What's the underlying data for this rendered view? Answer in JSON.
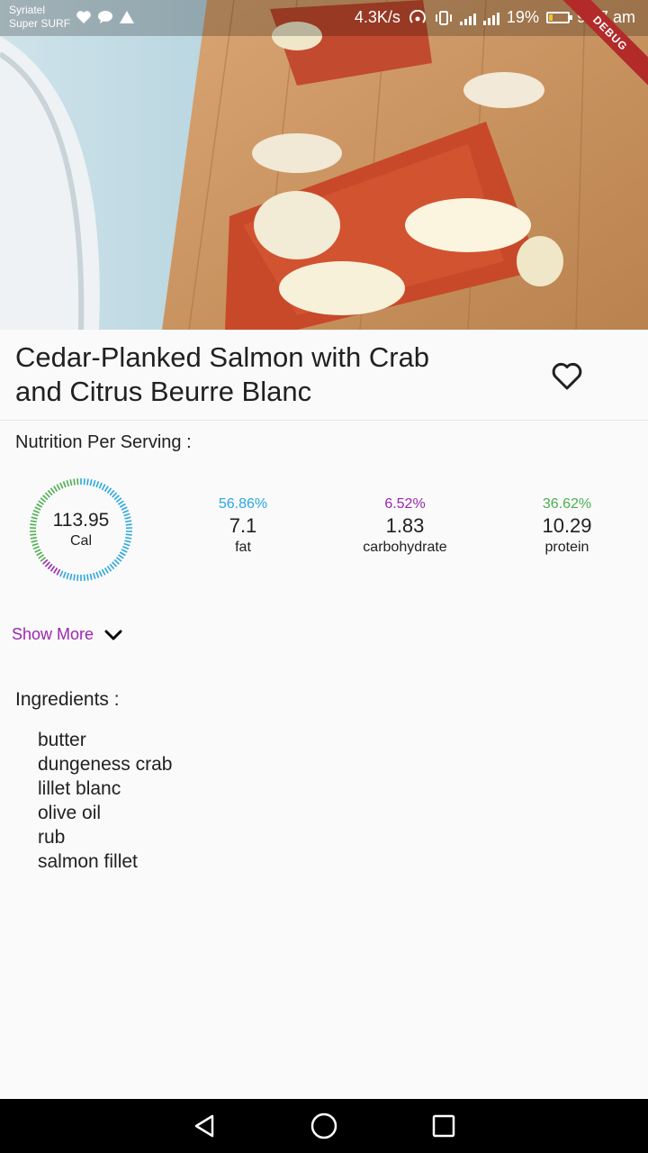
{
  "status_bar": {
    "carrier_line1": "Syriatel",
    "carrier_line2": "Super SURF",
    "speed": "4.3K/s",
    "battery": "19%",
    "time": "9:07 am",
    "battery_level": 0.19
  },
  "debug_banner": "DEBUG",
  "recipe": {
    "title_line1": "Cedar-Planked Salmon with Crab",
    "title_line2": "and Citrus Beurre Blanc",
    "favorite_icon": "heart-outline-icon"
  },
  "nutrition": {
    "heading": "Nutrition Per Serving :",
    "calories": "113.95",
    "calories_unit": "Cal",
    "macros": [
      {
        "percent": "56.86%",
        "value": "7.1",
        "label": "fat",
        "color": "#2aa7e0"
      },
      {
        "percent": "6.52%",
        "value": "1.83",
        "label": "carbohydrate",
        "color": "#9c27b0"
      },
      {
        "percent": "36.62%",
        "value": "10.29",
        "label": "protein",
        "color": "#4caf50"
      }
    ]
  },
  "show_more": {
    "label": "Show More",
    "icon": "chevron-down-icon",
    "color": "#9c27b0"
  },
  "ingredients": {
    "heading": "Ingredients :",
    "items": [
      "butter",
      "dungeness crab",
      "lillet blanc",
      "olive oil",
      "rub",
      "salmon fillet"
    ]
  },
  "nav": {
    "back_icon": "back-triangle-icon",
    "home_icon": "home-circle-icon",
    "recents_icon": "recents-square-icon"
  }
}
